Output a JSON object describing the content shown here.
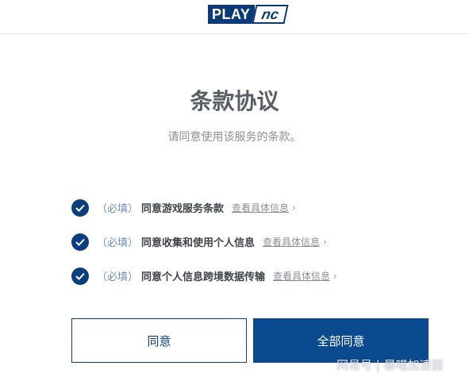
{
  "header": {
    "logo_play": "PLAY",
    "logo_nc": "nc"
  },
  "main": {
    "title": "条款协议",
    "subtitle": "请同意使用该服务的条款。"
  },
  "terms": [
    {
      "required": "（必填）",
      "label": "同意游戏服务条款",
      "detail": "查看具体信息",
      "checked": true
    },
    {
      "required": "（必填）",
      "label": "同意收集和使用个人信息",
      "detail": "查看具体信息",
      "checked": true
    },
    {
      "required": "（必填）",
      "label": "同意个人信息跨境数据传输",
      "detail": "查看具体信息",
      "checked": true
    }
  ],
  "buttons": {
    "agree": "同意",
    "agree_all": "全部同意"
  },
  "watermark": "网易号 | 暴喵加速器",
  "colors": {
    "brand": "#0a3f7d",
    "primary_button": "#0a4a8f"
  }
}
